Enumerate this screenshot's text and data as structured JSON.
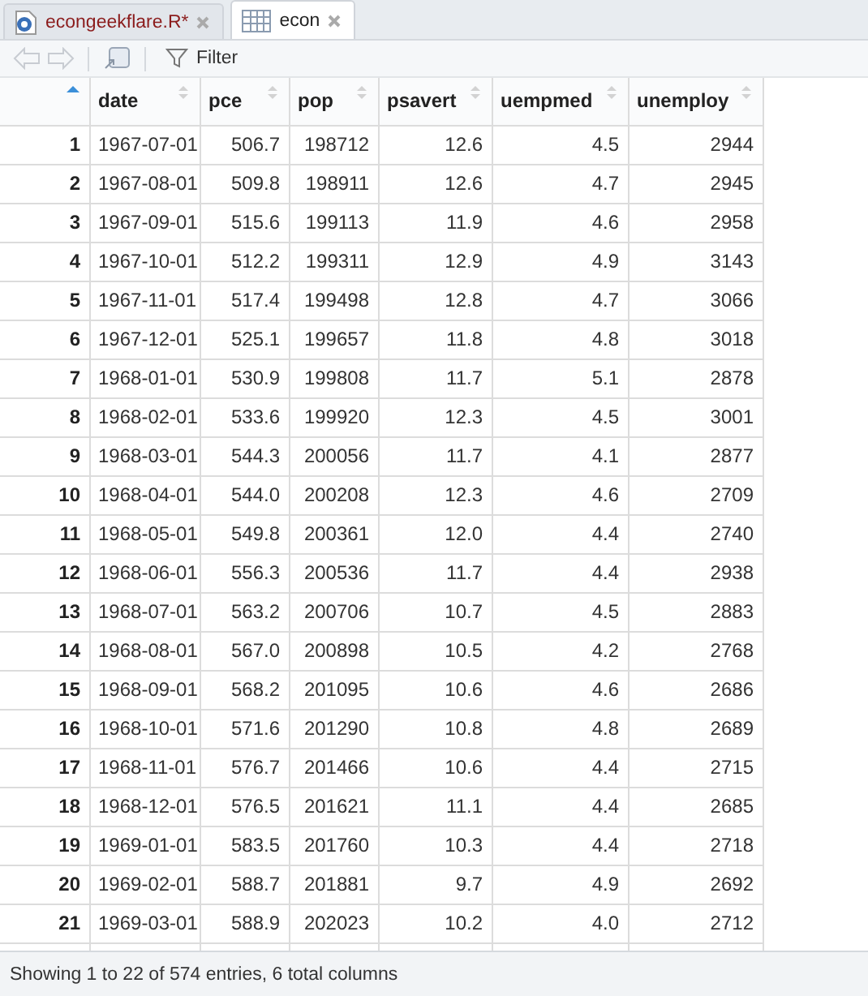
{
  "tabs": [
    {
      "label": "econgeekflare.R*",
      "kind": "script",
      "selected": false
    },
    {
      "label": "econ",
      "kind": "data",
      "selected": true
    }
  ],
  "toolbar": {
    "back_disabled": true,
    "forward_disabled": true,
    "filter_label": "Filter"
  },
  "table": {
    "index_sorted": true,
    "columns": [
      {
        "label": "date"
      },
      {
        "label": "pce"
      },
      {
        "label": "pop"
      },
      {
        "label": "psavert"
      },
      {
        "label": "uempmed"
      },
      {
        "label": "unemploy"
      }
    ],
    "rows": [
      {
        "index": "1",
        "cells": [
          "1967-07-01",
          "506.7",
          "198712",
          "12.6",
          "4.5",
          "2944"
        ]
      },
      {
        "index": "2",
        "cells": [
          "1967-08-01",
          "509.8",
          "198911",
          "12.6",
          "4.7",
          "2945"
        ]
      },
      {
        "index": "3",
        "cells": [
          "1967-09-01",
          "515.6",
          "199113",
          "11.9",
          "4.6",
          "2958"
        ]
      },
      {
        "index": "4",
        "cells": [
          "1967-10-01",
          "512.2",
          "199311",
          "12.9",
          "4.9",
          "3143"
        ]
      },
      {
        "index": "5",
        "cells": [
          "1967-11-01",
          "517.4",
          "199498",
          "12.8",
          "4.7",
          "3066"
        ]
      },
      {
        "index": "6",
        "cells": [
          "1967-12-01",
          "525.1",
          "199657",
          "11.8",
          "4.8",
          "3018"
        ]
      },
      {
        "index": "7",
        "cells": [
          "1968-01-01",
          "530.9",
          "199808",
          "11.7",
          "5.1",
          "2878"
        ]
      },
      {
        "index": "8",
        "cells": [
          "1968-02-01",
          "533.6",
          "199920",
          "12.3",
          "4.5",
          "3001"
        ]
      },
      {
        "index": "9",
        "cells": [
          "1968-03-01",
          "544.3",
          "200056",
          "11.7",
          "4.1",
          "2877"
        ]
      },
      {
        "index": "10",
        "cells": [
          "1968-04-01",
          "544.0",
          "200208",
          "12.3",
          "4.6",
          "2709"
        ]
      },
      {
        "index": "11",
        "cells": [
          "1968-05-01",
          "549.8",
          "200361",
          "12.0",
          "4.4",
          "2740"
        ]
      },
      {
        "index": "12",
        "cells": [
          "1968-06-01",
          "556.3",
          "200536",
          "11.7",
          "4.4",
          "2938"
        ]
      },
      {
        "index": "13",
        "cells": [
          "1968-07-01",
          "563.2",
          "200706",
          "10.7",
          "4.5",
          "2883"
        ]
      },
      {
        "index": "14",
        "cells": [
          "1968-08-01",
          "567.0",
          "200898",
          "10.5",
          "4.2",
          "2768"
        ]
      },
      {
        "index": "15",
        "cells": [
          "1968-09-01",
          "568.2",
          "201095",
          "10.6",
          "4.6",
          "2686"
        ]
      },
      {
        "index": "16",
        "cells": [
          "1968-10-01",
          "571.6",
          "201290",
          "10.8",
          "4.8",
          "2689"
        ]
      },
      {
        "index": "17",
        "cells": [
          "1968-11-01",
          "576.7",
          "201466",
          "10.6",
          "4.4",
          "2715"
        ]
      },
      {
        "index": "18",
        "cells": [
          "1968-12-01",
          "576.5",
          "201621",
          "11.1",
          "4.4",
          "2685"
        ]
      },
      {
        "index": "19",
        "cells": [
          "1969-01-01",
          "583.5",
          "201760",
          "10.3",
          "4.4",
          "2718"
        ]
      },
      {
        "index": "20",
        "cells": [
          "1969-02-01",
          "588.7",
          "201881",
          "9.7",
          "4.9",
          "2692"
        ]
      },
      {
        "index": "21",
        "cells": [
          "1969-03-01",
          "588.9",
          "202023",
          "10.2",
          "4.0",
          "2712"
        ]
      }
    ]
  },
  "status_bar": "Showing 1 to 22 of 574 entries, 6 total columns"
}
